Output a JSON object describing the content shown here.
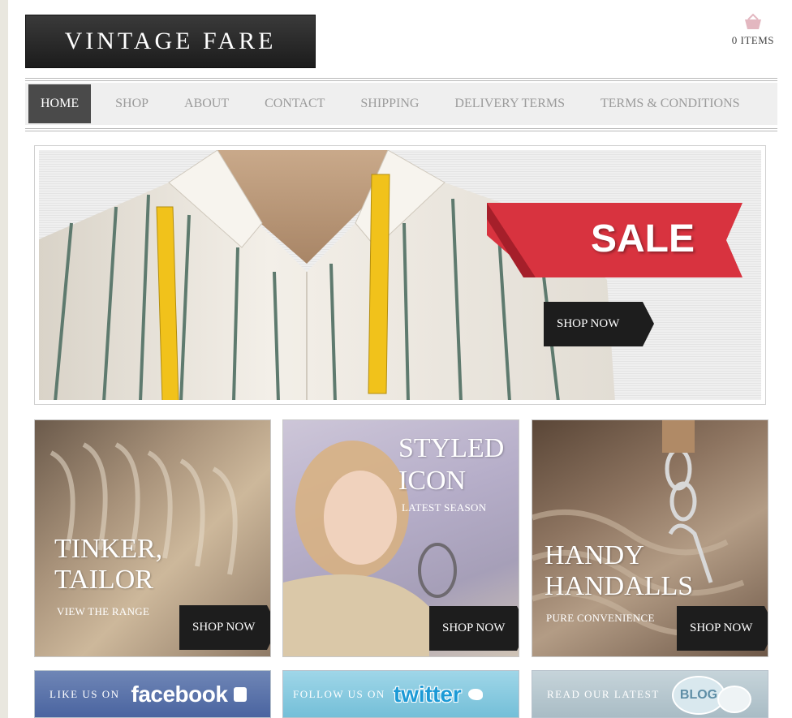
{
  "header": {
    "logo": "VINTAGE FARE",
    "cart": {
      "icon": "basket-icon",
      "label": "0 ITEMS"
    }
  },
  "nav": {
    "items": [
      {
        "label": "HOME",
        "active": true
      },
      {
        "label": "SHOP"
      },
      {
        "label": "ABOUT"
      },
      {
        "label": "CONTACT"
      },
      {
        "label": "SHIPPING"
      },
      {
        "label": "DELIVERY TERMS"
      },
      {
        "label": "TERMS & CONDITIONS"
      }
    ]
  },
  "hero": {
    "ribbon": "SALE",
    "button": "SHOP NOW",
    "colors": {
      "ribbon": "#d8333f",
      "button": "#1d1d1d"
    }
  },
  "tiles": [
    {
      "title1": "TINKER,",
      "title2": "TAILOR",
      "sub": "VIEW THE RANGE",
      "button": "SHOP NOW"
    },
    {
      "title1": "STYLED",
      "title2": "ICON",
      "sub": "LATEST SEASON",
      "button": "SHOP NOW"
    },
    {
      "title1": "HANDY",
      "title2": "HANDALLS",
      "sub": "PURE CONVENIENCE",
      "button": "SHOP NOW"
    }
  ],
  "social": [
    {
      "small": "LIKE US ON",
      "big": "facebook",
      "icon": "thumbs-up-icon"
    },
    {
      "small": "FOLLOW US ON",
      "big": "twitter",
      "icon": "bird-icon"
    },
    {
      "small": "READ OUR LATEST",
      "big": "BLOG",
      "icon": "speech-bubble-icon"
    }
  ]
}
